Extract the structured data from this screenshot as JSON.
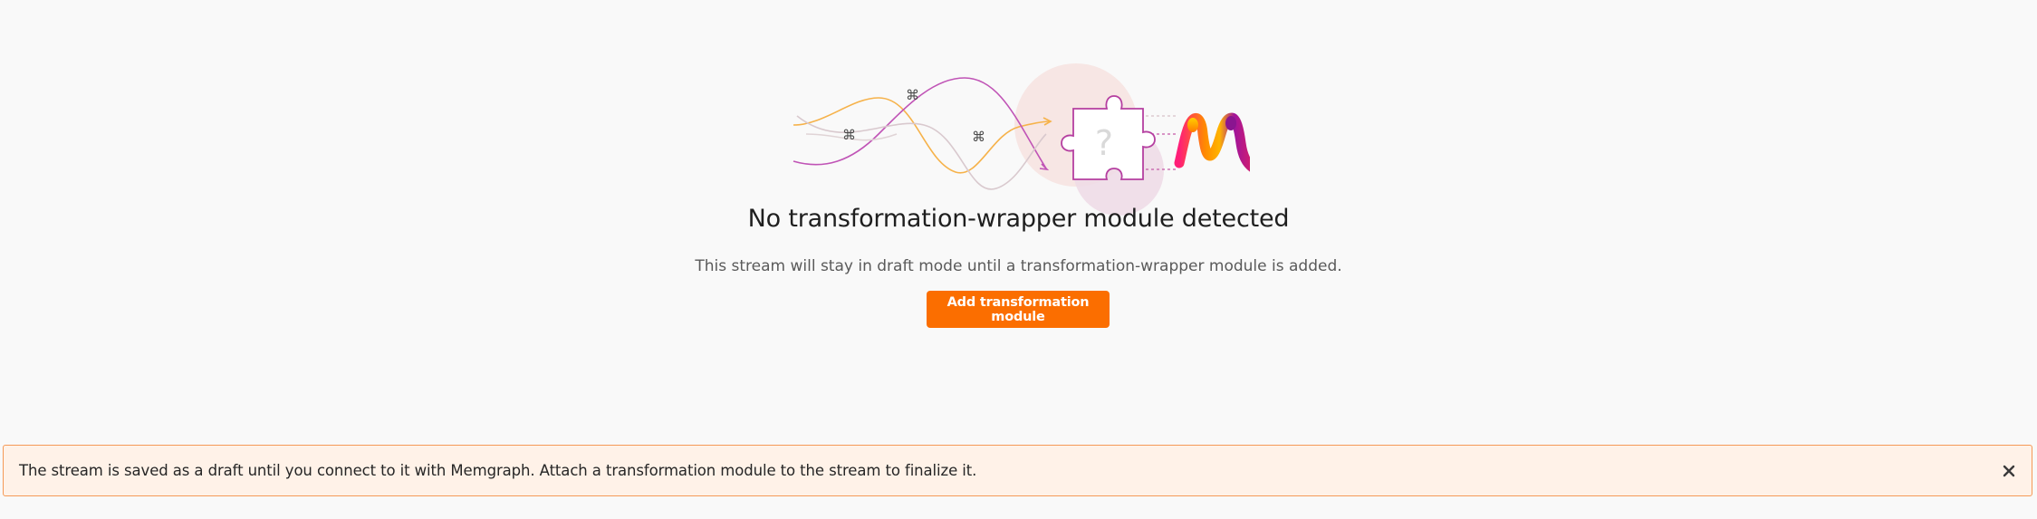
{
  "empty_state": {
    "title": "No transformation-wrapper module detected",
    "description": "This stream will stay in draft mode until a transformation-wrapper module is added.",
    "add_button_label": "Add transformation module",
    "illustration_icons": [
      "flow-lines-icon",
      "command-key-icon",
      "puzzle-piece-icon",
      "question-mark-icon",
      "memgraph-logo"
    ]
  },
  "notice": {
    "message": "The stream is saved as a draft until you connect to it with Memgraph. Attach a transformation module to the stream to finalize it.",
    "close_icon": "close-icon"
  },
  "colors": {
    "accent": "#fb6e00",
    "notice_background": "#fff2e8",
    "notice_border": "#f59a57",
    "page_background": "#f9f9f9"
  }
}
